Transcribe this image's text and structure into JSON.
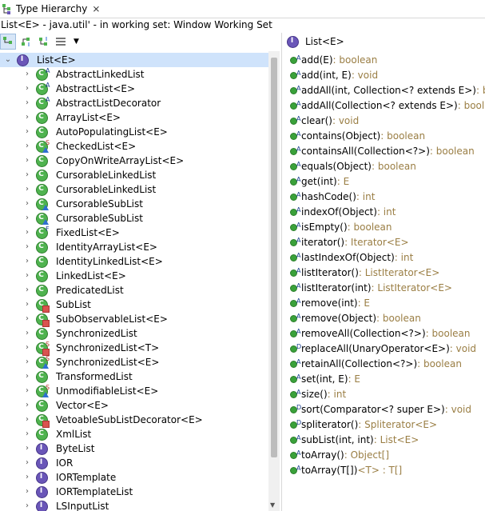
{
  "tab": {
    "title": "Type Hierarchy",
    "close": "⨯"
  },
  "status": "List<E> - java.util' - in working set: Window Working Set",
  "toolbar": {
    "dropdown": "▼"
  },
  "right_header": "List<E>",
  "root": {
    "label": "List<E>"
  },
  "tree": [
    {
      "label": "AbstractLinkedList",
      "kind": "class",
      "badge": "A",
      "overlay": ""
    },
    {
      "label": "AbstractList<E>",
      "kind": "class",
      "badge": "A",
      "overlay": ""
    },
    {
      "label": "AbstractListDecorator",
      "kind": "class",
      "badge": "A",
      "overlay": ""
    },
    {
      "label": "ArrayList<E>",
      "kind": "class",
      "badge": "",
      "overlay": ""
    },
    {
      "label": "AutoPopulatingList<E>",
      "kind": "class",
      "badge": "",
      "overlay": ""
    },
    {
      "label": "CheckedList<E>",
      "kind": "class",
      "badge": "S",
      "overlay": "blue"
    },
    {
      "label": "CopyOnWriteArrayList<E>",
      "kind": "class",
      "badge": "",
      "overlay": ""
    },
    {
      "label": "CursorableLinkedList",
      "kind": "class",
      "badge": "",
      "overlay": ""
    },
    {
      "label": "CursorableLinkedList",
      "kind": "class",
      "badge": "",
      "overlay": ""
    },
    {
      "label": "CursorableSubList",
      "kind": "class",
      "badge": "",
      "overlay": "blue"
    },
    {
      "label": "CursorableSubList",
      "kind": "class",
      "badge": "",
      "overlay": "blue"
    },
    {
      "label": "FixedList<E>",
      "kind": "class",
      "badge": "F",
      "overlay": ""
    },
    {
      "label": "IdentityArrayList<E>",
      "kind": "class",
      "badge": "",
      "overlay": ""
    },
    {
      "label": "IdentityLinkedList<E>",
      "kind": "class",
      "badge": "",
      "overlay": ""
    },
    {
      "label": "LinkedList<E>",
      "kind": "class",
      "badge": "",
      "overlay": ""
    },
    {
      "label": "PredicatedList",
      "kind": "class",
      "badge": "",
      "overlay": ""
    },
    {
      "label": "SubList",
      "kind": "class",
      "badge": "",
      "overlay": "red"
    },
    {
      "label": "SubObservableList<E>",
      "kind": "class",
      "badge": "",
      "overlay": "red"
    },
    {
      "label": "SynchronizedList",
      "kind": "class",
      "badge": "",
      "overlay": ""
    },
    {
      "label": "SynchronizedList<T>",
      "kind": "class",
      "badge": "S",
      "overlay": "red"
    },
    {
      "label": "SynchronizedList<E>",
      "kind": "class",
      "badge": "S",
      "overlay": "blue"
    },
    {
      "label": "TransformedList",
      "kind": "class",
      "badge": "",
      "overlay": ""
    },
    {
      "label": "UnmodifiableList<E>",
      "kind": "class",
      "badge": "S",
      "overlay": "blue"
    },
    {
      "label": "Vector<E>",
      "kind": "class",
      "badge": "",
      "overlay": ""
    },
    {
      "label": "VetoableSubListDecorator<E>",
      "kind": "class",
      "badge": "",
      "overlay": "red"
    },
    {
      "label": "XmlList",
      "kind": "class",
      "badge": "",
      "overlay": ""
    },
    {
      "label": "ByteList",
      "kind": "interface",
      "badge": "",
      "overlay": ""
    },
    {
      "label": "IOR",
      "kind": "interface",
      "badge": "",
      "overlay": ""
    },
    {
      "label": "IORTemplate",
      "kind": "interface",
      "badge": "",
      "overlay": ""
    },
    {
      "label": "IORTemplateList",
      "kind": "interface",
      "badge": "",
      "overlay": ""
    },
    {
      "label": "LSInputList",
      "kind": "interface",
      "badge": "",
      "overlay": ""
    }
  ],
  "methods": [
    {
      "sup": "A",
      "sig": "add(E)",
      "ret": " : boolean"
    },
    {
      "sup": "A",
      "sig": "add(int, E)",
      "ret": " : void"
    },
    {
      "sup": "A",
      "sig": "addAll(int, Collection<? extends E>)",
      "ret": " : boolean"
    },
    {
      "sup": "A",
      "sig": "addAll(Collection<? extends E>)",
      "ret": " : boolean"
    },
    {
      "sup": "A",
      "sig": "clear()",
      "ret": " : void"
    },
    {
      "sup": "A",
      "sig": "contains(Object)",
      "ret": " : boolean"
    },
    {
      "sup": "A",
      "sig": "containsAll(Collection<?>)",
      "ret": " : boolean"
    },
    {
      "sup": "A",
      "sig": "equals(Object)",
      "ret": " : boolean"
    },
    {
      "sup": "A",
      "sig": "get(int)",
      "ret": " : E"
    },
    {
      "sup": "A",
      "sig": "hashCode()",
      "ret": " : int"
    },
    {
      "sup": "A",
      "sig": "indexOf(Object)",
      "ret": " : int"
    },
    {
      "sup": "A",
      "sig": "isEmpty()",
      "ret": " : boolean"
    },
    {
      "sup": "A",
      "sig": "iterator()",
      "ret": " : Iterator<E>"
    },
    {
      "sup": "A",
      "sig": "lastIndexOf(Object)",
      "ret": " : int"
    },
    {
      "sup": "A",
      "sig": "listIterator()",
      "ret": " : ListIterator<E>"
    },
    {
      "sup": "A",
      "sig": "listIterator(int)",
      "ret": " : ListIterator<E>"
    },
    {
      "sup": "A",
      "sig": "remove(int)",
      "ret": " : E"
    },
    {
      "sup": "A",
      "sig": "remove(Object)",
      "ret": " : boolean"
    },
    {
      "sup": "A",
      "sig": "removeAll(Collection<?>)",
      "ret": " : boolean"
    },
    {
      "sup": "D",
      "sig": "replaceAll(UnaryOperator<E>)",
      "ret": " : void"
    },
    {
      "sup": "A",
      "sig": "retainAll(Collection<?>)",
      "ret": " : boolean"
    },
    {
      "sup": "A",
      "sig": "set(int, E)",
      "ret": " : E"
    },
    {
      "sup": "A",
      "sig": "size()",
      "ret": " : int"
    },
    {
      "sup": "D",
      "sig": "sort(Comparator<? super E>)",
      "ret": " : void"
    },
    {
      "sup": "D",
      "sig": "spliterator()",
      "ret": " : Spliterator<E>"
    },
    {
      "sup": "A",
      "sig": "subList(int, int)",
      "ret": " : List<E>"
    },
    {
      "sup": "A",
      "sig": "toArray()",
      "ret": " : Object[]"
    },
    {
      "sup": "A",
      "sig": "toArray(T[])",
      "ret": " <T> : T[]"
    }
  ]
}
